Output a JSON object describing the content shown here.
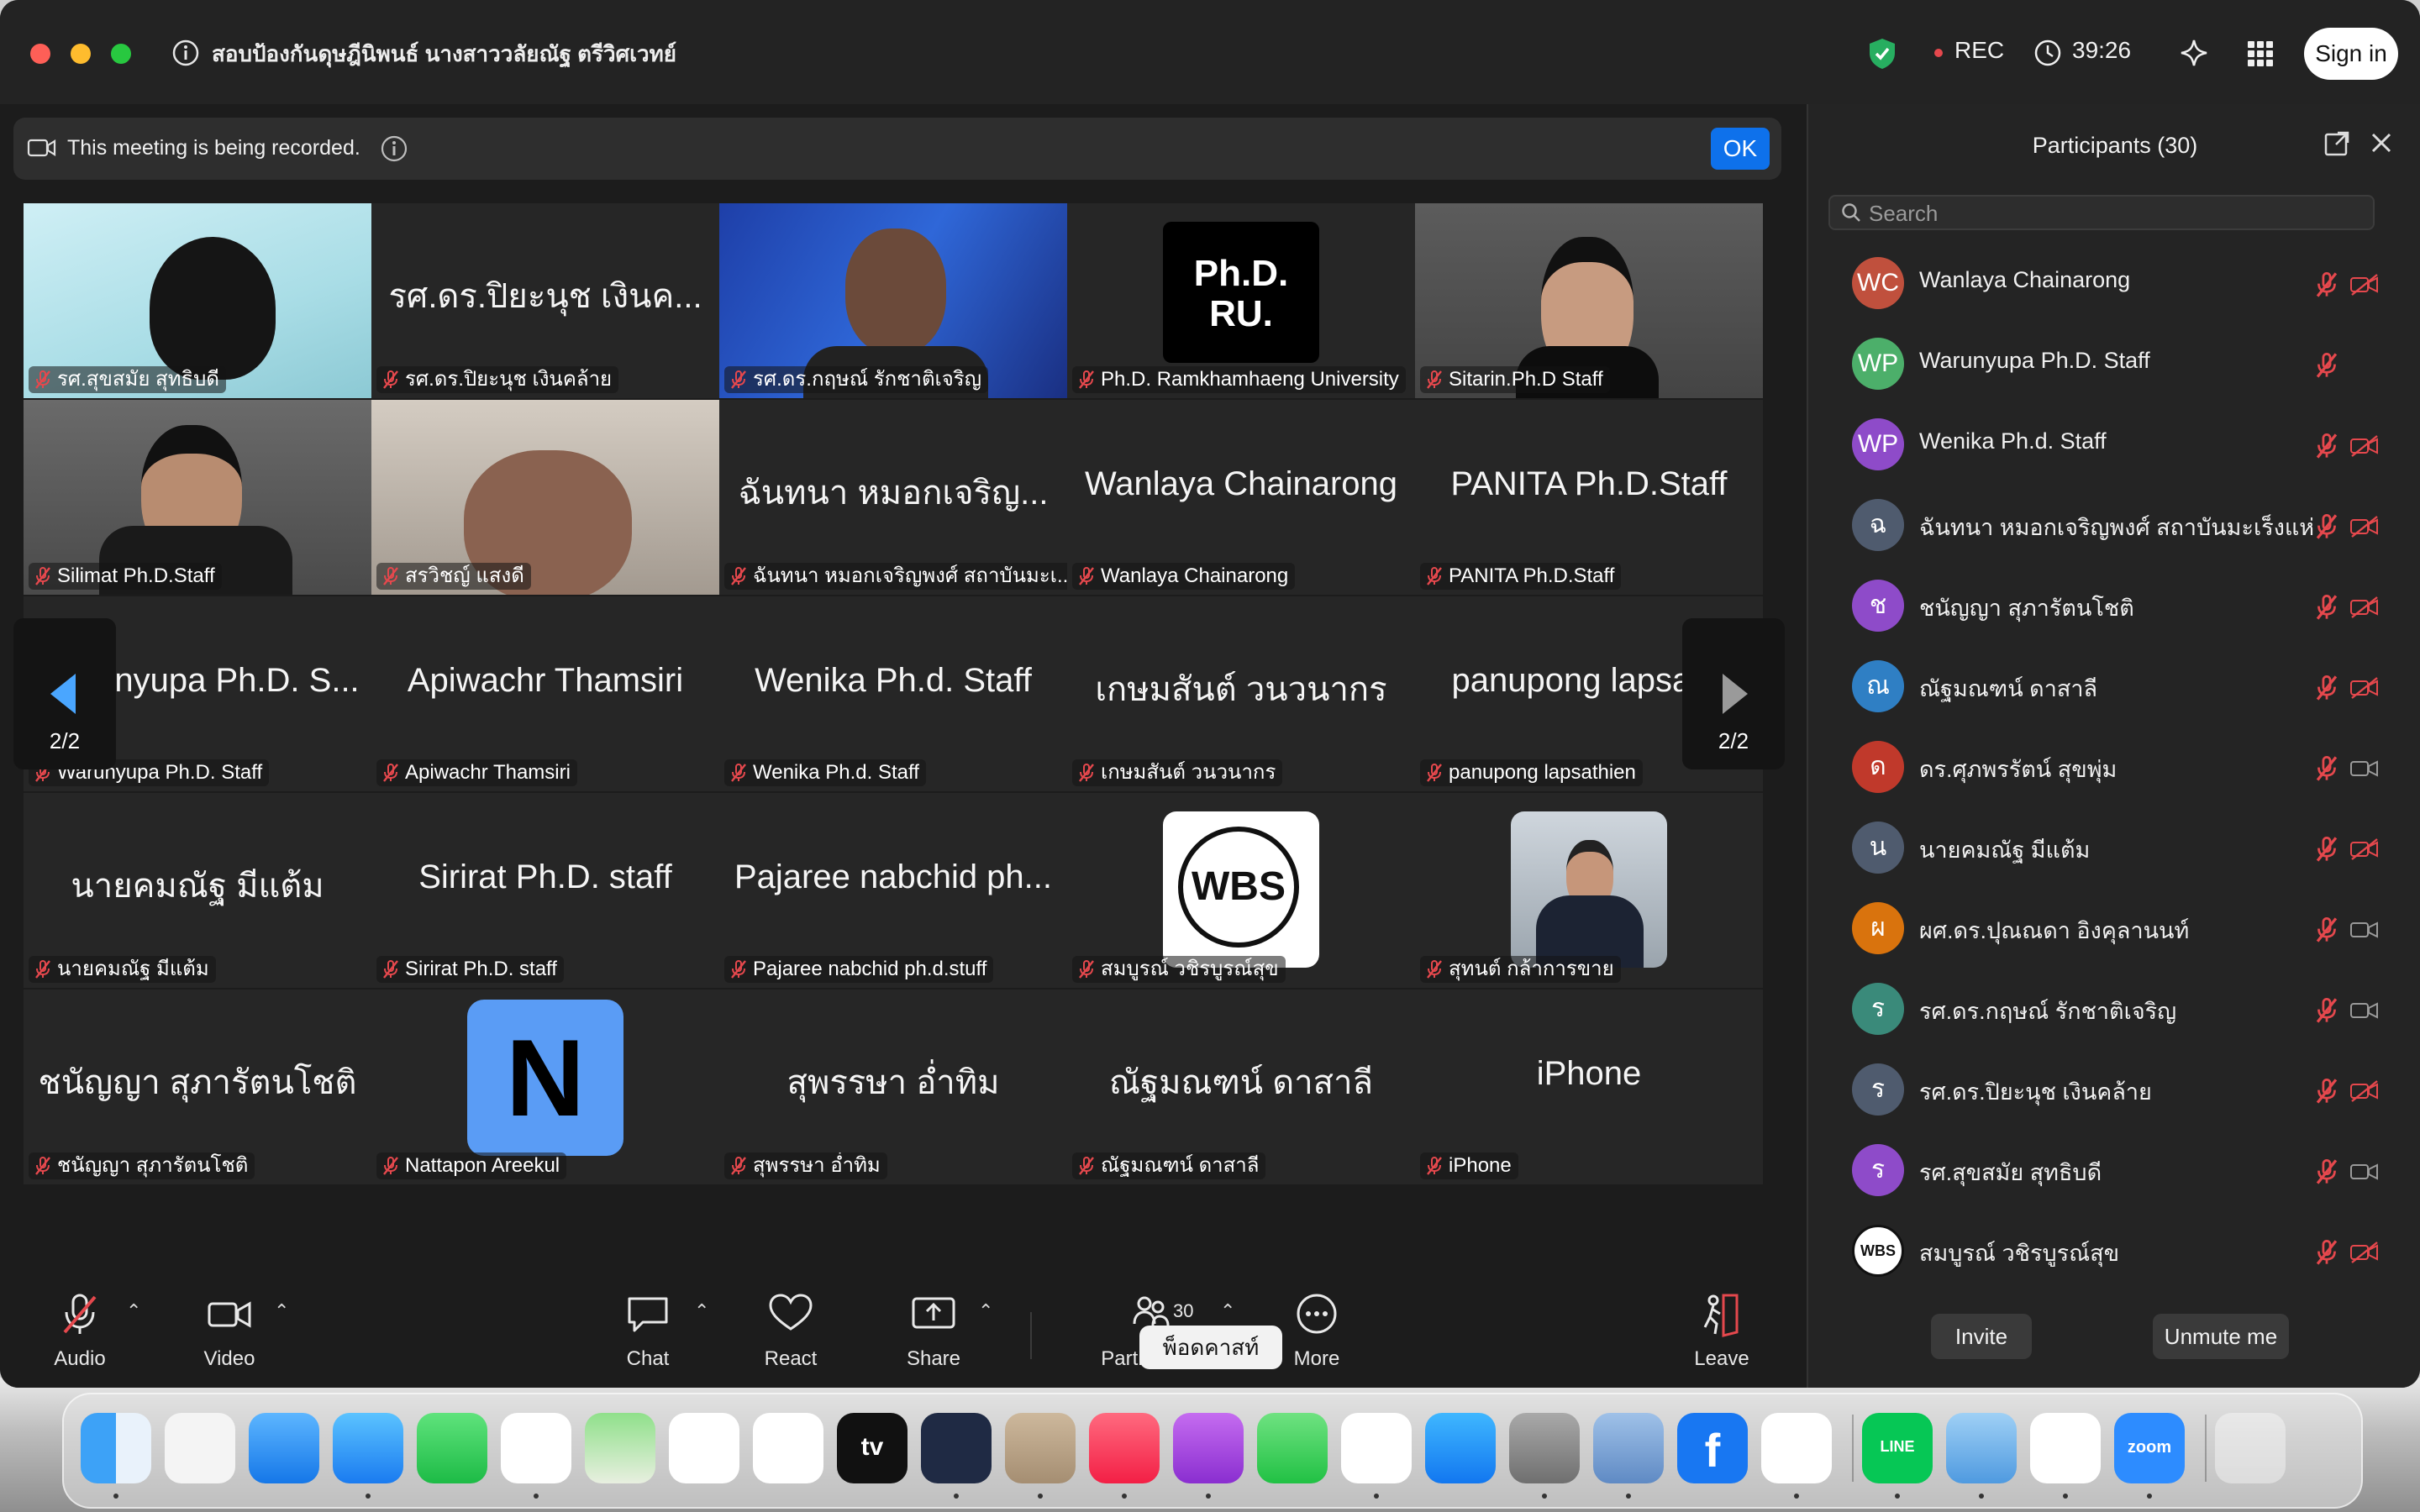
{
  "window": {
    "title": "สอบป้องกันดุษฎีนิพนธ์  นางสาววลัยณัฐ ตรีวิศเวทย์",
    "rec_label": "REC",
    "timer": "39:26",
    "sign_in": "Sign in"
  },
  "banner": {
    "text": "This meeting is being recorded.",
    "ok": "OK"
  },
  "gallery": {
    "page": "2/2",
    "tiles": [
      {
        "label": "รศ.สุขสมัย สุทธิบดี",
        "big": ""
      },
      {
        "label": "รศ.ดร.ปิยะนุช  เงินคล้าย",
        "big": "รศ.ดร.ปิยะนุช  เงินค..."
      },
      {
        "label": "รศ.ดร.กฤษณ์  รักชาติเจริญ",
        "big": ""
      },
      {
        "label": "Ph.D. Ramkhamhaeng University",
        "big": ""
      },
      {
        "label": "Sitarin.Ph.D Staff",
        "big": ""
      },
      {
        "label": "Silimat Ph.D.Staff",
        "big": ""
      },
      {
        "label": "สรวิชญ์  แสงดี",
        "big": ""
      },
      {
        "label": "ฉันทนา หมอกเจริญพงศ์ สถาบันมะเ...",
        "big": "ฉันทนา หมอกเจริญ..."
      },
      {
        "label": "Wanlaya Chainarong",
        "big": "Wanlaya Chainarong"
      },
      {
        "label": "PANITA Ph.D.Staff",
        "big": "PANITA Ph.D.Staff"
      },
      {
        "label": "Warunyupa Ph.D. Staff",
        "big": "Warunyupa Ph.D. S..."
      },
      {
        "label": "Apiwachr Thamsiri",
        "big": "Apiwachr Thamsiri"
      },
      {
        "label": "Wenika Ph.d. Staff",
        "big": "Wenika Ph.d. Staff"
      },
      {
        "label": "เกษมสันต์ วนวนากร",
        "big": "เกษมสันต์ วนวนากร"
      },
      {
        "label": "panupong lapsathien",
        "big": "panupong lapsathi"
      },
      {
        "label": "นายคมณัฐ มีแต้ม",
        "big": "นายคมณัฐ มีแต้ม"
      },
      {
        "label": "Sirirat Ph.D. staff",
        "big": "Sirirat Ph.D. staff"
      },
      {
        "label": "Pajaree nabchid ph.d.stuff",
        "big": "Pajaree nabchid ph..."
      },
      {
        "label": "สมบูรณ์ วชิรบูรณ์สุข",
        "big": ""
      },
      {
        "label": "สุทนต์ กล้าการขาย",
        "big": ""
      },
      {
        "label": "ชนัญญา สุภารัตนโชติ",
        "big": "ชนัญญา สุภารัตนโชติ"
      },
      {
        "label": "Nattapon Areekul",
        "big": ""
      },
      {
        "label": "สุพรรษา อ่ำทิม",
        "big": "สุพรรษา อ่ำทิม"
      },
      {
        "label": "ณัฐมณฑน์ ดาสาลี",
        "big": "ณัฐมณฑน์ ดาสาลี"
      },
      {
        "label": "iPhone",
        "big": "iPhone"
      }
    ],
    "logo_phd_ru": "Ph.D. RU.",
    "logo_n": "N",
    "logo_wbs": "WBS"
  },
  "toolbar": {
    "audio": "Audio",
    "video": "Video",
    "chat": "Chat",
    "react": "React",
    "share": "Share",
    "participants": "Participants",
    "participants_count": "30",
    "more": "More",
    "leave": "Leave",
    "tooltip": "พ็อดคาสท์"
  },
  "panel": {
    "title": "Participants (30)",
    "search_placeholder": "Search",
    "invite": "Invite",
    "unmute": "Unmute me",
    "participants": [
      {
        "initials": "WC",
        "name": "Wanlaya Chainarong",
        "color": "#c0503d",
        "cam": "off"
      },
      {
        "initials": "WP",
        "name": "Warunyupa Ph.D. Staff",
        "color": "#4caf6a",
        "cam": "none"
      },
      {
        "initials": "WP",
        "name": "Wenika Ph.d. Staff",
        "color": "#8e4bc9",
        "cam": "off"
      },
      {
        "initials": "ฉ",
        "name": "ฉันทนา หมอกเจริญพงศ์ สถาบันมะเร็งแห่...",
        "color": "#4f5b6e",
        "cam": "off"
      },
      {
        "initials": "ช",
        "name": "ชนัญญา สุภารัตนโชติ",
        "color": "#8e4bc9",
        "cam": "off"
      },
      {
        "initials": "ณ",
        "name": "ณัฐมณฑน์ ดาสาลี",
        "color": "#2f7fc4",
        "cam": "off"
      },
      {
        "initials": "ด",
        "name": "ดร.ศุภพรรัตน์  สุขพุ่ม",
        "color": "#c0392b",
        "cam": "on"
      },
      {
        "initials": "น",
        "name": "นายคมณัฐ มีแต้ม",
        "color": "#4f5b6e",
        "cam": "off"
      },
      {
        "initials": "ผ",
        "name": "ผศ.ดร.ปุณณดา  อิงคุลานนท์",
        "color": "#d9730d",
        "cam": "on"
      },
      {
        "initials": "ร",
        "name": "รศ.ดร.กฤษณ์  รักชาติเจริญ",
        "color": "#3a8a7a",
        "cam": "on"
      },
      {
        "initials": "ร",
        "name": "รศ.ดร.ปิยะนุช  เงินคล้าย",
        "color": "#4f5b6e",
        "cam": "off"
      },
      {
        "initials": "ร",
        "name": "รศ.สุขสมัย สุทธิบดี",
        "color": "#8e4bc9",
        "cam": "on"
      },
      {
        "initials": "WBS",
        "name": "สมบูรณ์ วชิรบูรณ์สุข",
        "color": "#ffffff",
        "cam": "off"
      }
    ]
  },
  "dock": {
    "apps": [
      "finder-icon",
      "launchpad-icon",
      "mail-icon",
      "safari-icon",
      "facetime-icon",
      "chrome-icon",
      "maps-icon",
      "reminders-icon",
      "photos-icon",
      "appletv-icon",
      "sketch-icon",
      "contacts-icon",
      "music-icon",
      "podcasts-icon",
      "messages-icon",
      "news-icon",
      "appstore-icon",
      "settings-icon",
      "preview-icon",
      "facebook-icon",
      "gmail-icon",
      "line-icon",
      "owl-icon",
      "word-icon",
      "zoom-icon",
      "trash-icon"
    ],
    "appletv_label": "tv",
    "line_label": "LINE",
    "zoom_label": "zoom"
  },
  "colors": {
    "accent": "#0e71eb",
    "mute_red": "#e5484d",
    "shield_green": "#27ae60"
  }
}
